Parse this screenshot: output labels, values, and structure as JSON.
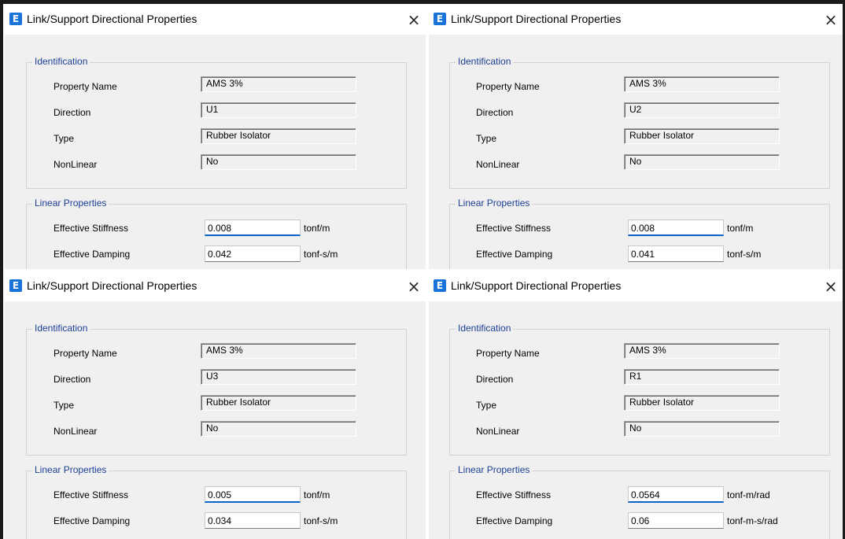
{
  "dialogs": [
    {
      "title": "Link/Support Directional Properties",
      "close_glyph": "×",
      "identification": {
        "group_title": "Identification",
        "property_name_label": "Property Name",
        "property_name": "AMS 3%",
        "direction_label": "Direction",
        "direction": "U1",
        "type_label": "Type",
        "type": "Rubber Isolator",
        "nonlinear_label": "NonLinear",
        "nonlinear": "No"
      },
      "linear": {
        "group_title": "Linear Properties",
        "stiffness_label": "Effective Stiffness",
        "stiffness": "0.008",
        "stiffness_unit": "tonf/m",
        "damping_label": "Effective Damping",
        "damping": "0.042",
        "damping_unit": "tonf-s/m"
      }
    },
    {
      "title": "Link/Support Directional Properties",
      "close_glyph": "×",
      "identification": {
        "group_title": "Identification",
        "property_name_label": "Property Name",
        "property_name": "AMS 3%",
        "direction_label": "Direction",
        "direction": "U2",
        "type_label": "Type",
        "type": "Rubber Isolator",
        "nonlinear_label": "NonLinear",
        "nonlinear": "No"
      },
      "linear": {
        "group_title": "Linear Properties",
        "stiffness_label": "Effective Stiffness",
        "stiffness": "0.008",
        "stiffness_unit": "tonf/m",
        "damping_label": "Effective Damping",
        "damping": "0.041",
        "damping_unit": "tonf-s/m"
      }
    },
    {
      "title": "Link/Support Directional Properties",
      "close_glyph": "×",
      "identification": {
        "group_title": "Identification",
        "property_name_label": "Property Name",
        "property_name": "AMS 3%",
        "direction_label": "Direction",
        "direction": "U3",
        "type_label": "Type",
        "type": "Rubber Isolator",
        "nonlinear_label": "NonLinear",
        "nonlinear": "No"
      },
      "linear": {
        "group_title": "Linear Properties",
        "stiffness_label": "Effective Stiffness",
        "stiffness": "0.005",
        "stiffness_unit": "tonf/m",
        "damping_label": "Effective Damping",
        "damping": "0.034",
        "damping_unit": "tonf-s/m"
      }
    },
    {
      "title": "Link/Support Directional Properties",
      "close_glyph": "×",
      "identification": {
        "group_title": "Identification",
        "property_name_label": "Property Name",
        "property_name": "AMS 3%",
        "direction_label": "Direction",
        "direction": "R1",
        "type_label": "Type",
        "type": "Rubber Isolator",
        "nonlinear_label": "NonLinear",
        "nonlinear": "No"
      },
      "linear": {
        "group_title": "Linear Properties",
        "stiffness_label": "Effective Stiffness",
        "stiffness": "0.0564",
        "stiffness_unit": "tonf-m/rad",
        "damping_label": "Effective Damping",
        "damping": "0.06",
        "damping_unit": "tonf-m-s/rad"
      }
    }
  ],
  "app_icon_letter": "E",
  "app_icon_name": "etabs-app-icon",
  "brand_color": "#1a73d9",
  "group_title_color": "#1c3f94"
}
